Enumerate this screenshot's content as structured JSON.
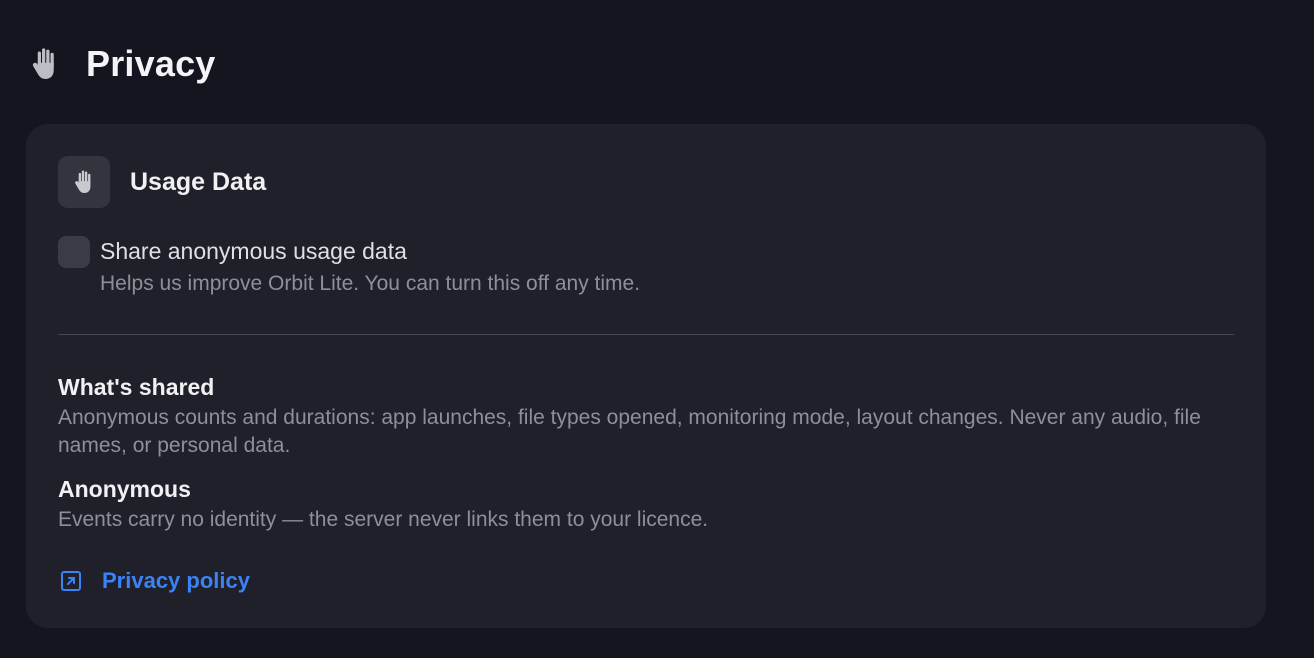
{
  "header": {
    "icon": "hand-icon",
    "title": "Privacy"
  },
  "usage_card": {
    "icon": "hand-icon",
    "title": "Usage Data",
    "toggle": {
      "label": "Share anonymous usage data",
      "help": "Helps us improve Orbit Lite. You can turn this off any time.",
      "checked": false
    },
    "sections": [
      {
        "title": "What's shared",
        "body": "Anonymous counts and durations: app launches, file types opened, monitoring mode, layout changes. Never any audio, file names, or personal data."
      },
      {
        "title": "Anonymous",
        "body": "Events carry no identity — the server never links them to your licence."
      }
    ],
    "link": {
      "icon": "external-link-icon",
      "label": "Privacy policy"
    }
  },
  "colors": {
    "background": "#14151f",
    "card": "#1f2029",
    "accent": "#3b82f6",
    "muted_text": "#8e8f98"
  }
}
